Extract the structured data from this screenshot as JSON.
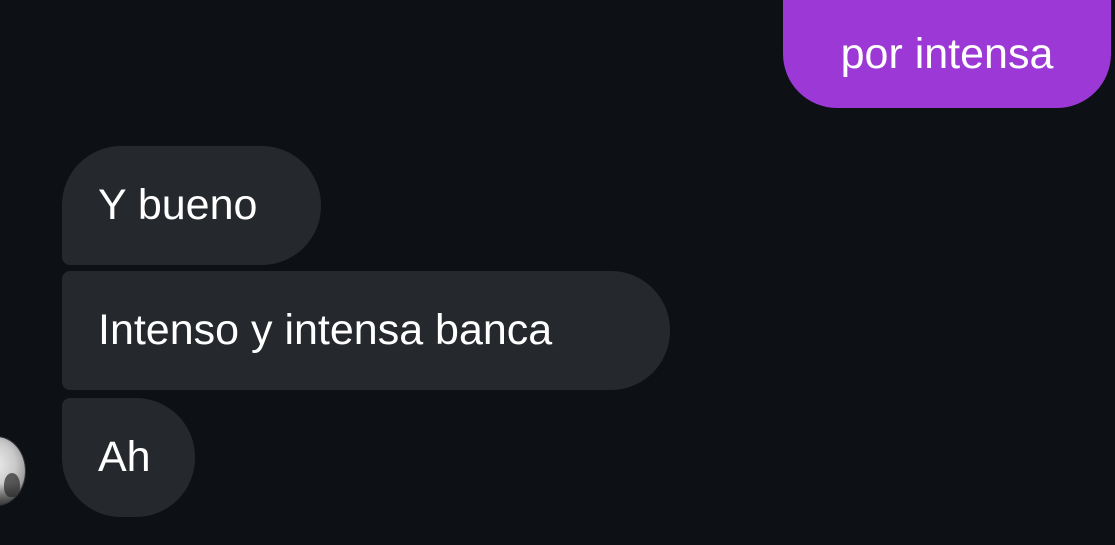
{
  "conversation": {
    "messages": [
      {
        "direction": "outgoing",
        "text": "por intensa"
      },
      {
        "direction": "incoming",
        "text": "Y bueno"
      },
      {
        "direction": "incoming",
        "text": "Intenso y intensa banca"
      },
      {
        "direction": "incoming",
        "text": "Ah"
      }
    ]
  },
  "colors": {
    "background": "#0d1015",
    "outgoing_bubble": "#9b38d6",
    "incoming_bubble": "#25282d",
    "text": "#ffffff"
  },
  "icons": {
    "avatar": "contact-avatar"
  }
}
